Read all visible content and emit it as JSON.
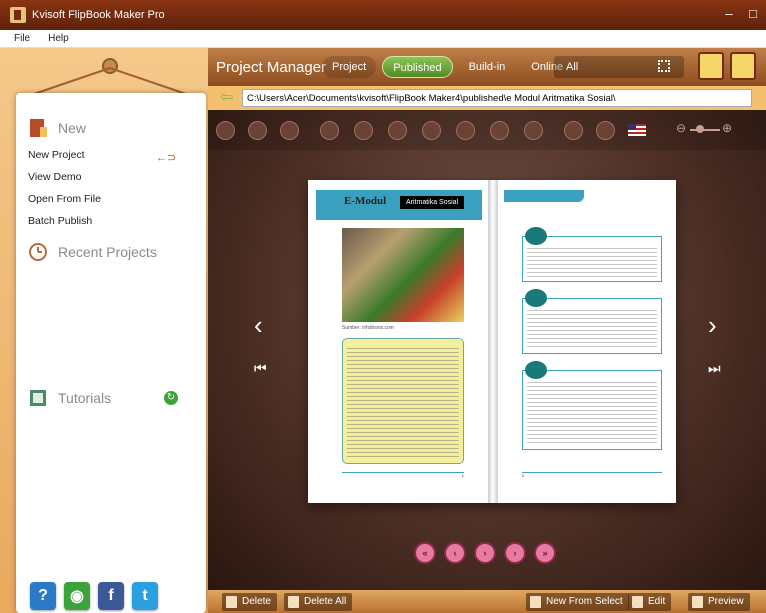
{
  "window": {
    "title": "Kvisoft FlipBook Maker Pro",
    "min": "–",
    "max": "□",
    "close": "×"
  },
  "menu": {
    "file": "File",
    "help": "Help"
  },
  "left": {
    "new_head": "New",
    "links": [
      "New Project",
      "View Demo",
      "Open From File",
      "Batch Publish"
    ],
    "arrow_hint": "←⊃",
    "recent_head": "Recent Projects",
    "tutorials_head": "Tutorials",
    "refresh": "↻",
    "social": {
      "help": "?",
      "web": "◉",
      "facebook": "f",
      "twitter": "t"
    }
  },
  "manager": {
    "title": "Project Manager",
    "tabs": [
      "Project",
      "Published",
      "Build-in",
      "Online"
    ],
    "active_tab": "Published",
    "filter": "All",
    "path": "C:\\Users\\Acer\\Documents\\kvisoft\\FlipBook Maker4\\published\\e Modul Aritmatika Sosial\\"
  },
  "book": {
    "left_title": "E-Modul",
    "left_title_black": "Aritmatika Sosial",
    "photo_caption": "Sumber: infobisnis.com",
    "page_num_left": "1",
    "page_num_right": "2"
  },
  "pager": [
    "«",
    "‹",
    "›",
    "›",
    "»"
  ],
  "bottom": {
    "delete": "Delete",
    "delete_all": "Delete All",
    "new_from_select": "New From Select",
    "edit": "Edit",
    "preview": "Preview"
  },
  "colors": {
    "title_bar": "#5e220b",
    "accent": "#4f8a22",
    "panel": "#e9a95e"
  }
}
